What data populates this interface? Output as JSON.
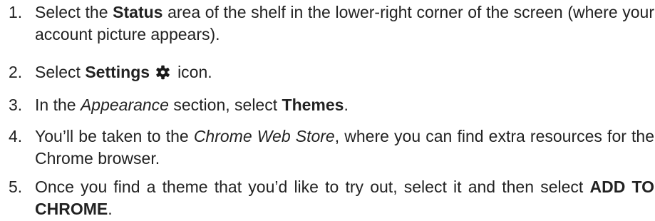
{
  "steps": [
    {
      "number": "1.",
      "pre": "Select the ",
      "bold": "Status",
      "post": " area of the shelf in the lower-right corner of the screen (where your account picture appears)."
    },
    {
      "number": "2.",
      "pre": "Select ",
      "bold": "Settings",
      "icon": "gear-icon",
      "post": "icon."
    },
    {
      "number": "3.",
      "pre": "In the ",
      "italic": "Appearance",
      "mid": " section, select ",
      "bold": "Themes",
      "post": "."
    },
    {
      "number": "4.",
      "pre": "You’ll be taken to the ",
      "italic": "Chrome Web Store",
      "post": ", where you can find extra resources for the Chrome browser."
    },
    {
      "number": "5.",
      "pre": "Once you find a theme that you’d like to try out, select it and then select ",
      "bold": "ADD TO CHROME",
      "post": "."
    }
  ]
}
